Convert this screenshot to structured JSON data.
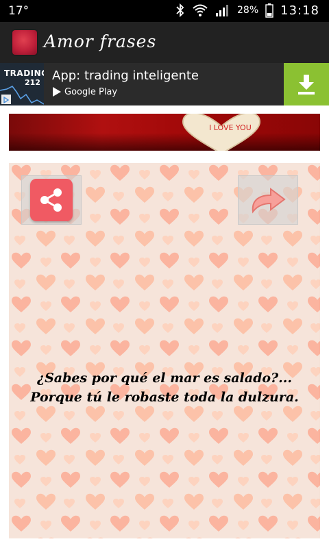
{
  "status_bar": {
    "temperature": "17°",
    "battery_percent": "28%",
    "time": "13:18",
    "icons": [
      "bluetooth-icon",
      "wifi-icon",
      "signal-icon",
      "battery-icon"
    ]
  },
  "action_bar": {
    "title": "Amor frases",
    "icon": "app-heart-icon"
  },
  "ad": {
    "logo_line1": "TRADING",
    "logo_line2": "212",
    "title": "App: trading inteligente",
    "store": "Google Play",
    "button_icon": "download-icon",
    "colors": {
      "button": "#8bc132",
      "background": "#2b2b2b"
    }
  },
  "header_image": {
    "image": "candy-heart-photo",
    "caption": "I LOVE YOU"
  },
  "card": {
    "share_icon": "share-icon",
    "next_icon": "forward-arrow-icon",
    "phrase_line1": "¿Sabes por qué el mar es salado?...",
    "phrase_line2": "Porque tú le robaste toda la dulzura.",
    "colors": {
      "share": "#f05a63",
      "hearts": "#fbb49f"
    }
  }
}
